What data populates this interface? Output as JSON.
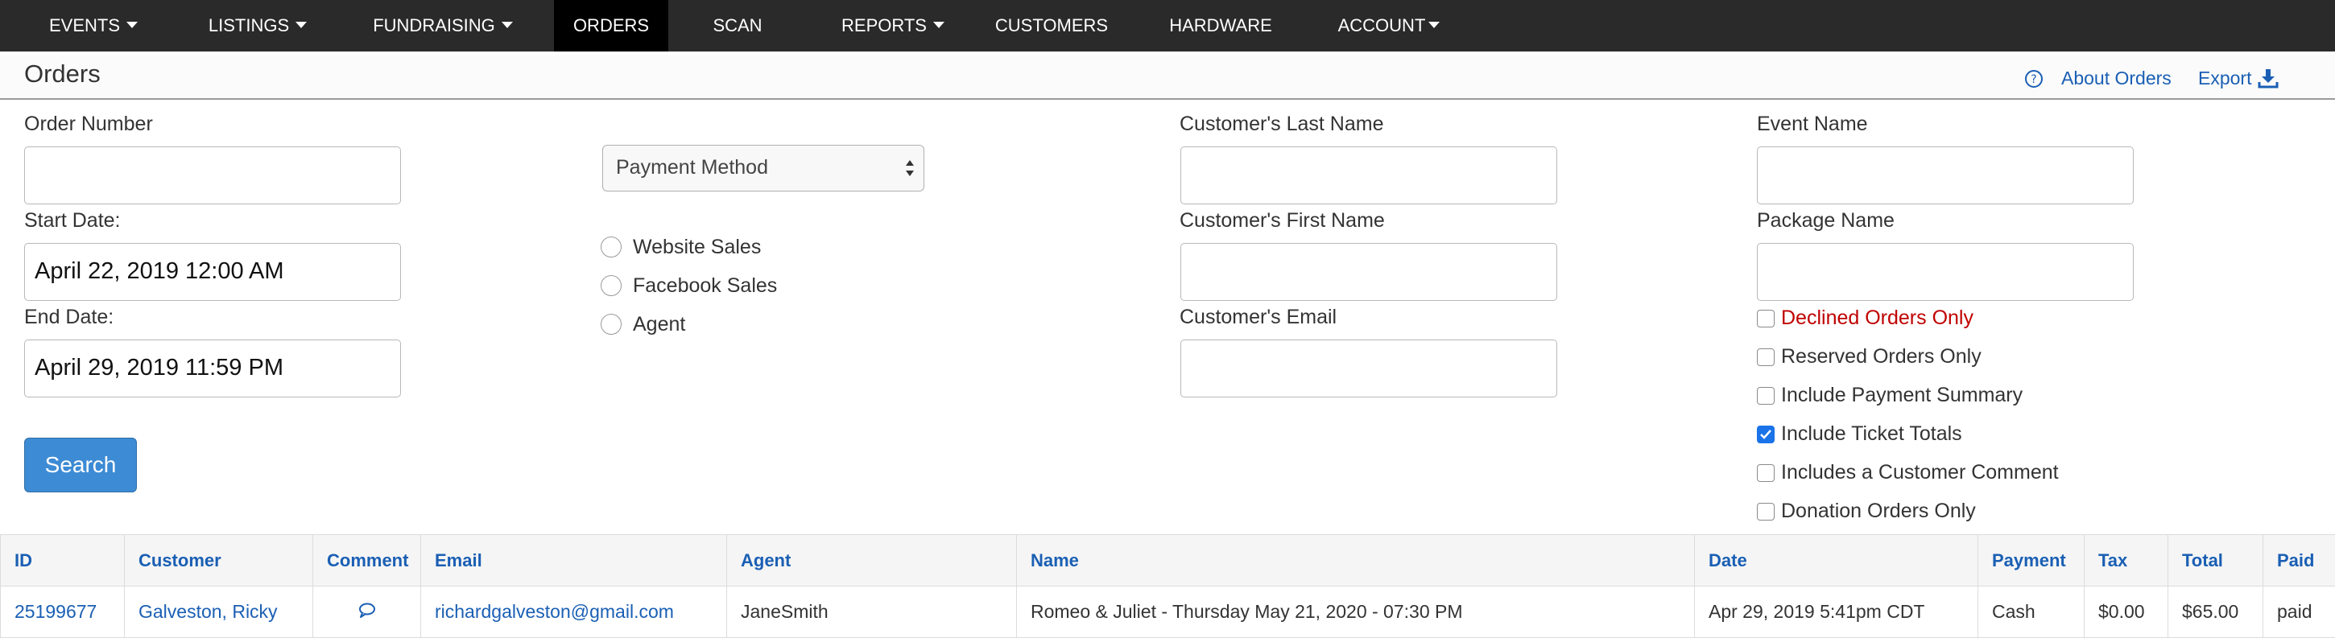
{
  "nav": {
    "items": [
      {
        "label": "EVENTS",
        "dropdown": true
      },
      {
        "label": "LISTINGS",
        "dropdown": true
      },
      {
        "label": "FUNDRAISING",
        "dropdown": true
      },
      {
        "label": "ORDERS",
        "dropdown": false,
        "active": true
      },
      {
        "label": "SCAN",
        "dropdown": false
      },
      {
        "label": "REPORTS",
        "dropdown": true
      },
      {
        "label": "CUSTOMERS",
        "dropdown": false
      },
      {
        "label": "HARDWARE",
        "dropdown": false
      },
      {
        "label": "ACCOUNT",
        "dropdown": true
      }
    ]
  },
  "header": {
    "title": "Orders",
    "about_label": "About Orders",
    "export_label": "Export"
  },
  "form": {
    "order_number_label": "Order Number",
    "order_number_value": "",
    "start_date_label": "Start Date:",
    "start_date_value": "April 22, 2019 12:00 AM",
    "end_date_label": "End Date:",
    "end_date_value": "April 29, 2019 11:59 PM",
    "payment_method_selected": "Payment Method",
    "sales_channels": [
      "Website Sales",
      "Facebook Sales",
      "Agent"
    ],
    "last_name_label": "Customer's Last Name",
    "first_name_label": "Customer's First Name",
    "email_label": "Customer's Email",
    "event_name_label": "Event Name",
    "package_name_label": "Package Name",
    "filters": [
      {
        "label": "Declined Orders Only",
        "checked": false,
        "highlight": "#c00000"
      },
      {
        "label": "Reserved Orders Only",
        "checked": false
      },
      {
        "label": "Include Payment Summary",
        "checked": false
      },
      {
        "label": "Include Ticket Totals",
        "checked": true
      },
      {
        "label": "Includes a Customer Comment",
        "checked": false
      },
      {
        "label": "Donation Orders Only",
        "checked": false
      }
    ],
    "search_label": "Search"
  },
  "table": {
    "columns": [
      "ID",
      "Customer",
      "Comment",
      "Email",
      "Agent",
      "Name",
      "Date",
      "Payment",
      "Tax",
      "Total",
      "Paid"
    ],
    "rows": [
      {
        "id": "25199677",
        "customer": "Galveston, Ricky",
        "comment_icon": "comment-icon",
        "email": "richardgalveston@gmail.com",
        "agent": "JaneSmith",
        "name": "Romeo & Juliet - Thursday May 21, 2020 - 07:30 PM",
        "date": "Apr 29, 2019 5:41pm CDT",
        "payment": "Cash",
        "tax": "$0.00",
        "total": "$65.00",
        "paid": "paid"
      }
    ]
  },
  "colors": {
    "nav_bg": "#2a2a2a",
    "nav_active_bg": "#000000",
    "link": "#1a5fb4",
    "button": "#3d8bd4",
    "declined": "#c00000"
  }
}
